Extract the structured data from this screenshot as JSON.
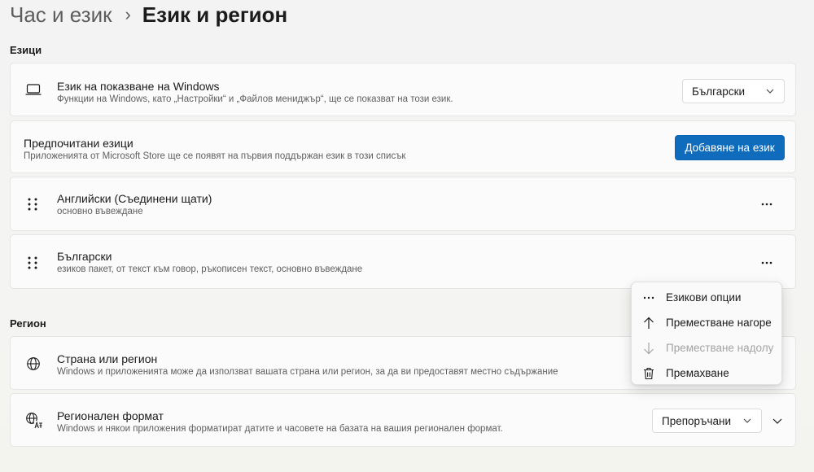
{
  "breadcrumb": {
    "parent": "Час и език",
    "separator": "›",
    "current": "Език и регион"
  },
  "languages_section": {
    "title": "Езици",
    "display_language": {
      "icon": "monitor-icon",
      "title": "Език на показване на Windows",
      "description": "Функции на Windows, като „Настройки“ и „Файлов мениджър“, ще се показват на този език.",
      "selected": "Български"
    },
    "preferred": {
      "title": "Предпочитани езици",
      "description": "Приложенията от Microsoft Store ще се появят на първия поддържан език в този списък",
      "add_button": "Добавяне на език"
    },
    "items": [
      {
        "title": "Английски (Съединени щати)",
        "description": "основно въвеждане"
      },
      {
        "title": "Български",
        "description": "езиков пакет, от текст към говор, ръкописен текст, основно въвеждане"
      }
    ]
  },
  "region_section": {
    "title": "Регион",
    "country": {
      "icon": "globe-icon",
      "title": "Страна или регион",
      "description": "Windows и приложенията може да използват вашата страна или регион, за да ви предоставят местно съдържание"
    },
    "format": {
      "icon": "regional-format-icon",
      "title": "Регионален формат",
      "description": "Windows и някои приложения форматират датите и часовете на базата на вашия регионален формат.",
      "selected": "Препоръчани"
    }
  },
  "context_menu": {
    "items": [
      {
        "label": "Езикови опции",
        "icon": "more-icon",
        "disabled": false
      },
      {
        "label": "Преместване нагоре",
        "icon": "arrow-up-icon",
        "disabled": false
      },
      {
        "label": "Преместване надолу",
        "icon": "arrow-down-icon",
        "disabled": true
      },
      {
        "label": "Премахване",
        "icon": "trash-icon",
        "disabled": false
      }
    ]
  },
  "colors": {
    "accent": "#0f6cbd",
    "card_background": "#fbfbfb",
    "page_background": "#f3f3f3",
    "secondary_text": "#5f5f5f",
    "disabled_text": "#a3a3a3"
  }
}
